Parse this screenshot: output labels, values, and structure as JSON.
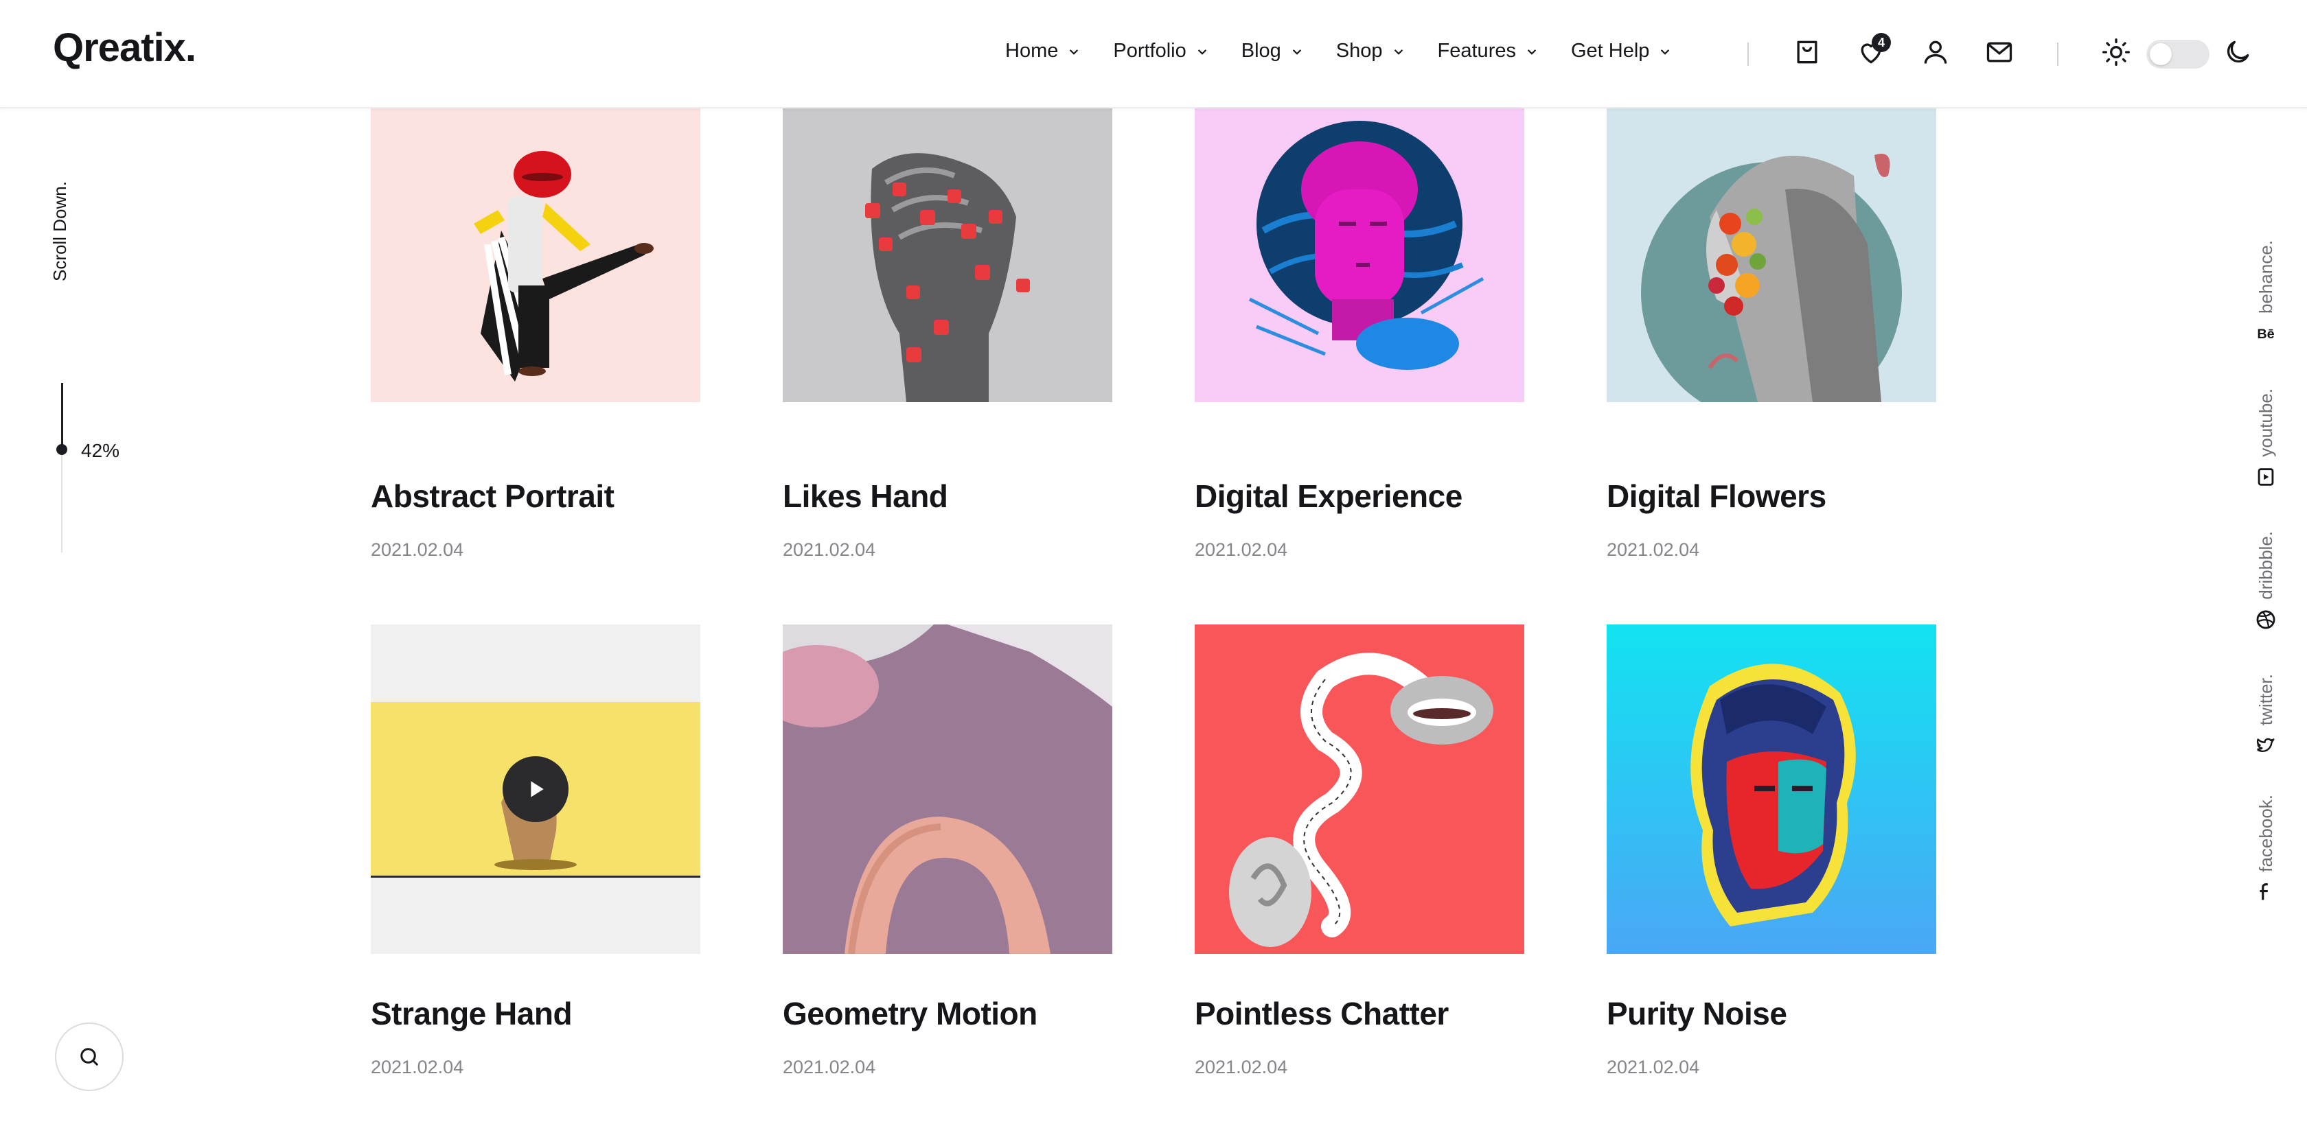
{
  "logo": "Qreatix.",
  "nav": [
    {
      "label": "Home"
    },
    {
      "label": "Portfolio"
    },
    {
      "label": "Blog"
    },
    {
      "label": "Shop"
    },
    {
      "label": "Features"
    },
    {
      "label": "Get Help"
    }
  ],
  "header_icons": {
    "cart": "shopping-bag-icon",
    "wishlist": "heart-icon",
    "wishlist_count": "4",
    "account": "user-icon",
    "mail": "mail-icon",
    "light": "sun-icon",
    "dark": "moon-icon",
    "theme_toggle_on": false
  },
  "scroll": {
    "label": "Scroll Down.",
    "percent": "42%",
    "progress": 0.42
  },
  "social": [
    {
      "label": "behance.",
      "icon": "behance-icon"
    },
    {
      "label": "youtube.",
      "icon": "youtube-icon"
    },
    {
      "label": "dribbble.",
      "icon": "dribbble-icon"
    },
    {
      "label": "twitter.",
      "icon": "twitter-icon"
    },
    {
      "label": "facebook.",
      "icon": "facebook-icon"
    }
  ],
  "portfolio": [
    {
      "title": "Abstract Portrait",
      "date": "2021.02.04"
    },
    {
      "title": "Likes Hand",
      "date": "2021.02.04"
    },
    {
      "title": "Digital Experience",
      "date": "2021.02.04"
    },
    {
      "title": "Digital Flowers",
      "date": "2021.02.04"
    },
    {
      "title": "Strange Hand",
      "date": "2021.02.04"
    },
    {
      "title": "Geometry Motion",
      "date": "2021.02.04"
    },
    {
      "title": "Pointless Chatter",
      "date": "2021.02.04"
    },
    {
      "title": "Purity Noise",
      "date": "2021.02.04"
    }
  ],
  "colors": {
    "text": "#15161a",
    "muted": "#84858a",
    "accent_dark": "#1c1d22"
  }
}
